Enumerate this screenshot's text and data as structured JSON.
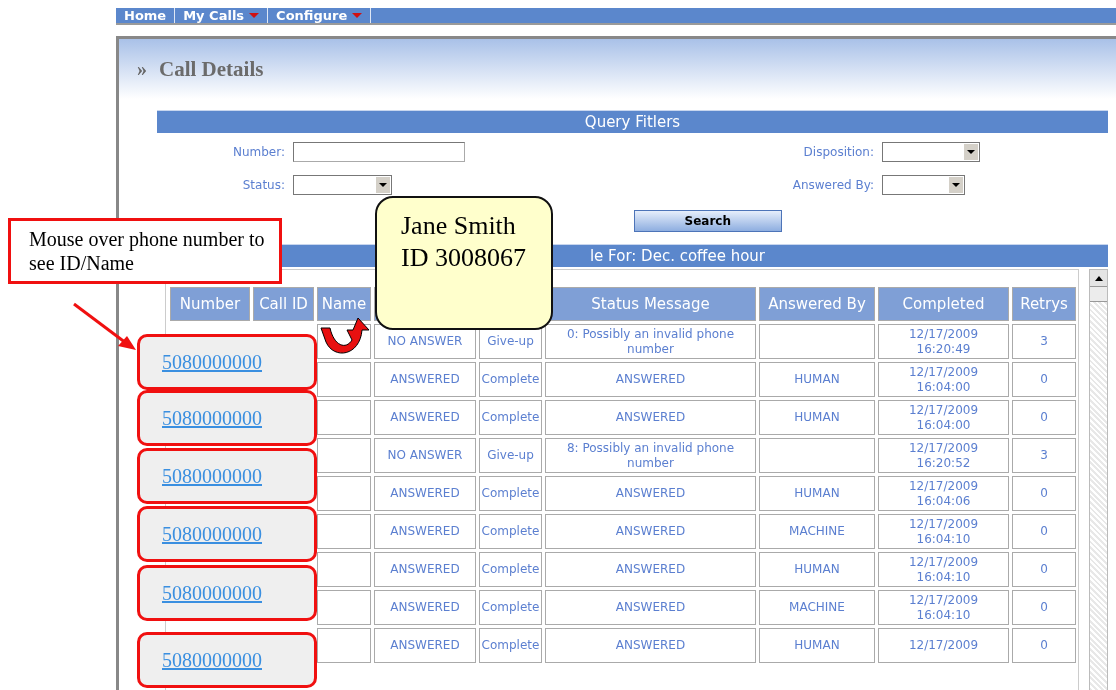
{
  "nav": [
    {
      "label": "Home",
      "dropdown": false
    },
    {
      "label": "My Calls",
      "dropdown": true
    },
    {
      "label": "Configure",
      "dropdown": true
    }
  ],
  "panel": {
    "marker": "»",
    "title": "Call Details"
  },
  "filters": {
    "title": "Query Fitlers",
    "left": [
      {
        "label": "Number:",
        "kind": "text"
      },
      {
        "label": "Status:",
        "kind": "select"
      }
    ],
    "right": [
      {
        "label": "Disposition:",
        "kind": "select"
      },
      {
        "label": "Answered By:",
        "kind": "select"
      }
    ],
    "button": "Search"
  },
  "table": {
    "title": "le For: Dec. coffee hour",
    "columns": [
      {
        "label": "Number"
      },
      {
        "label": "Call ID"
      },
      {
        "label": "Name"
      },
      {},
      {},
      {
        "label": "Status Message"
      },
      {
        "label": "Answered By"
      },
      {
        "label": "Completed"
      },
      {
        "label": "Retrys"
      }
    ],
    "rows": [
      {
        "cells": [
          "",
          "",
          "",
          "NO ANSWER",
          "Give-up",
          "0: Possibly an invalid phone number",
          "",
          "12/17/2009\n16:20:49",
          "3"
        ]
      },
      {
        "cells": [
          "",
          "",
          "",
          "ANSWERED",
          "Complete",
          "ANSWERED",
          "HUMAN",
          "12/17/2009\n16:04:00",
          "0"
        ]
      },
      {
        "cells": [
          "",
          "",
          "",
          "ANSWERED",
          "Complete",
          "ANSWERED",
          "HUMAN",
          "12/17/2009\n16:04:00",
          "0"
        ]
      },
      {
        "cells": [
          "",
          "",
          "",
          "NO ANSWER",
          "Give-up",
          "8: Possibly an invalid phone number",
          "",
          "12/17/2009\n16:20:52",
          "3"
        ]
      },
      {
        "cells": [
          "",
          "",
          "",
          "ANSWERED",
          "Complete",
          "ANSWERED",
          "HUMAN",
          "12/17/2009\n16:04:06",
          "0"
        ]
      },
      {
        "cells": [
          "",
          "",
          "",
          "ANSWERED",
          "Complete",
          "ANSWERED",
          "MACHINE",
          "12/17/2009\n16:04:10",
          "0"
        ]
      },
      {
        "cells": [
          "",
          "",
          "",
          "ANSWERED",
          "Complete",
          "ANSWERED",
          "HUMAN",
          "12/17/2009\n16:04:10",
          "0"
        ]
      },
      {
        "cells": [
          "",
          "",
          "",
          "ANSWERED",
          "Complete",
          "ANSWERED",
          "MACHINE",
          "12/17/2009\n16:04:10",
          "0"
        ]
      },
      {
        "cells": [
          "",
          "",
          "",
          "ANSWERED",
          "Complete",
          "ANSWERED",
          "HUMAN",
          "12/17/2009",
          "0"
        ]
      }
    ]
  },
  "annotation": {
    "note": "Mouse over phone number to see ID/Name",
    "tooltip": [
      "Jane Smith",
      "ID 3008067"
    ],
    "numbers": [
      "5080000000",
      "5080000000",
      "5080000000",
      "5080000000",
      "5080000000",
      "5080000000"
    ]
  }
}
